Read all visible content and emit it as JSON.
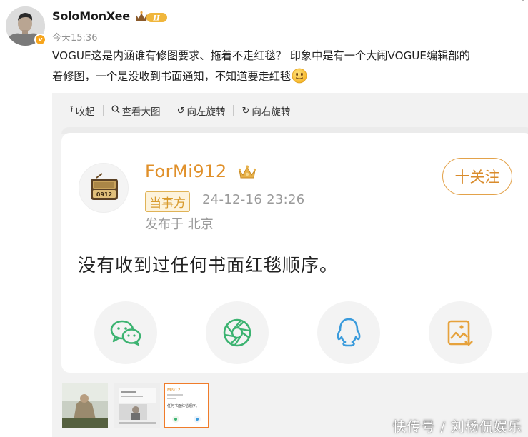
{
  "post": {
    "username": "SoloMonXee",
    "member_level": "II",
    "verified_mark": "v",
    "timestamp": "今天15:36",
    "text_line1": "VOGUE这是内涵谁有修图要求、拖着不走红毯？ 印象中是有一个大闹VOGUE编辑部的",
    "text_line2": "着修图，一个是没收到书面通知，不知道要走红毯",
    "emoji": "slightly-smiling-face-emoji"
  },
  "toolbar": {
    "collapse": "收起",
    "view_large": "查看大图",
    "rotate_left": "向左旋转",
    "rotate_right": "向右旋转",
    "icons": [
      "collapse-arrow-icon",
      "magnifier-icon",
      "rotate-left-icon",
      "rotate-right-icon"
    ]
  },
  "image_card": {
    "avatar_label": "0912",
    "name": "ForMi912",
    "role_badge": "当事方",
    "time": "24-12-16 23:26",
    "location": "发布于 北京",
    "follow_button": "十关注",
    "text": "没有收到过任何书面红毯顺序。",
    "share_icons": [
      "wechat-icon",
      "moments-icon",
      "qq-icon",
      "save-image-icon"
    ]
  },
  "thumbnails": {
    "count": 3,
    "active_index": 2,
    "thumb3_name": "MI912",
    "thumb3_text": "任何书面红毯顺序。"
  },
  "watermark": "快传号 / 刘杨侃娱乐",
  "colors": {
    "accent_orange": "#e0902a",
    "active_thumb_border": "#f07c2a",
    "verified_badge": "#f7a51c",
    "share_green": "#3cb371",
    "share_blue": "#3a9bdc"
  }
}
